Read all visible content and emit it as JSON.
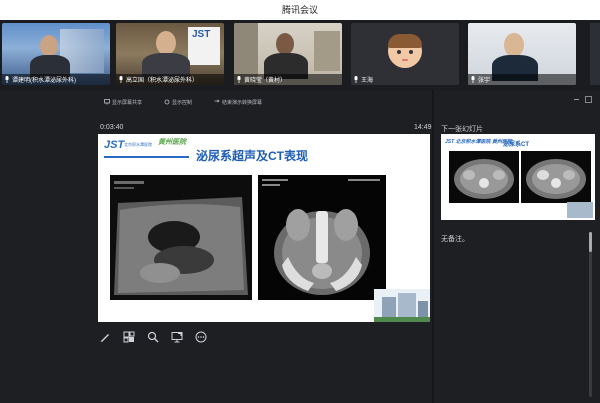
{
  "window": {
    "title": "腾讯会议"
  },
  "participants": [
    {
      "name": "谭建明(积水潭泌尿外科)"
    },
    {
      "name": "高立国（积水潭泌尿外科）"
    },
    {
      "name": "黄晓莹（黄村）"
    },
    {
      "name": "王海"
    },
    {
      "name": "张宇"
    }
  ],
  "share_toolbar": {
    "items": [
      "显示屏幕共享",
      "显示控制",
      "结束演示转换屏幕"
    ]
  },
  "presenter": {
    "elapsed": "0:03:40",
    "clock": "14:49",
    "next_slide_label": "下一张幻灯片",
    "notes": "无备注。"
  },
  "slide": {
    "logo_text": "JST",
    "logo_sub": "北京积水潭医院",
    "logo_cn": "黄州医院",
    "title": "泌尿系超声及CT表现"
  },
  "next_slide": {
    "logo_text": "JST 北京积水潭医院 黄州医院",
    "title": "泌尿系CT"
  },
  "tools": [
    "pen-tool",
    "slides-grid",
    "zoom",
    "screen-presentation",
    "more-options"
  ],
  "colors": {
    "accent_blue": "#1d5db8",
    "logo_green": "#5ba84b",
    "bg_dark": "#1e1f22"
  }
}
